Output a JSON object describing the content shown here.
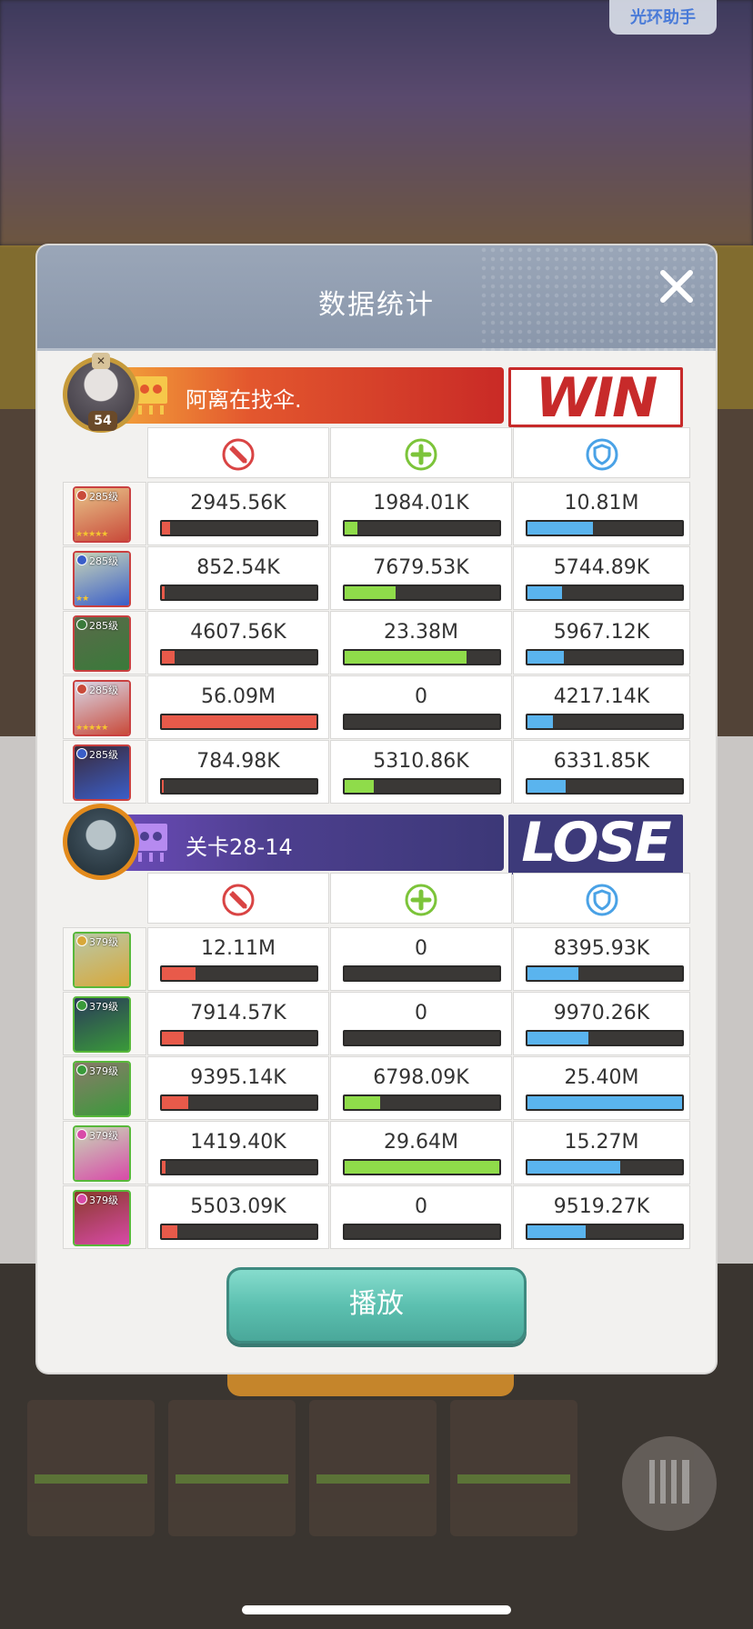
{
  "helper_badge": "光环助手",
  "dialog": {
    "title": "数据统计",
    "play_button": "播放"
  },
  "stat_columns": [
    "damage-icon",
    "heal-icon",
    "shield-icon"
  ],
  "colors": {
    "damage": "#e85a4a",
    "heal": "#8fdc4a",
    "shield": "#5ab4ee",
    "win_red": "#c72a2a",
    "lose_purple": "#3d3a7a"
  },
  "team_win": {
    "name": "阿离在找伞.",
    "level": "54",
    "result": "WIN",
    "heroes": [
      {
        "level": "285级",
        "stars": "★★★★★",
        "damage": "2945.56K",
        "heal": "1984.01K",
        "shield": "10.81M",
        "damage_pct": 5.3,
        "heal_pct": 8.5,
        "shield_pct": 42.6
      },
      {
        "level": "285级",
        "stars": "★★",
        "damage": "852.54K",
        "heal": "7679.53K",
        "shield": "5744.89K",
        "damage_pct": 1.5,
        "heal_pct": 32.8,
        "shield_pct": 22.6
      },
      {
        "level": "285级",
        "stars": "",
        "damage": "4607.56K",
        "heal": "23.38M",
        "shield": "5967.12K",
        "damage_pct": 8.2,
        "heal_pct": 78.9,
        "shield_pct": 23.5
      },
      {
        "level": "285级",
        "stars": "★★★★★",
        "damage": "56.09M",
        "heal": "0",
        "shield": "4217.14K",
        "damage_pct": 100,
        "heal_pct": 0,
        "shield_pct": 16.6
      },
      {
        "level": "285级",
        "stars": "",
        "damage": "784.98K",
        "heal": "5310.86K",
        "shield": "6331.85K",
        "damage_pct": 1.4,
        "heal_pct": 18.7,
        "shield_pct": 24.9
      }
    ]
  },
  "team_lose": {
    "name": "关卡28-14",
    "result": "LOSE",
    "heroes": [
      {
        "level": "379级",
        "damage": "12.11M",
        "heal": "0",
        "shield": "8395.93K",
        "damage_pct": 21.6,
        "heal_pct": 0,
        "shield_pct": 33.1
      },
      {
        "level": "379级",
        "damage": "7914.57K",
        "heal": "0",
        "shield": "9970.26K",
        "damage_pct": 14.1,
        "heal_pct": 0,
        "shield_pct": 39.3
      },
      {
        "level": "379级",
        "damage": "9395.14K",
        "heal": "6798.09K",
        "shield": "25.40M",
        "damage_pct": 16.8,
        "heal_pct": 22.9,
        "shield_pct": 100
      },
      {
        "level": "379级",
        "damage": "1419.40K",
        "heal": "29.64M",
        "shield": "15.27M",
        "damage_pct": 2.5,
        "heal_pct": 100,
        "shield_pct": 60.1
      },
      {
        "level": "379级",
        "damage": "5503.09K",
        "heal": "0",
        "shield": "9519.27K",
        "damage_pct": 9.8,
        "heal_pct": 0,
        "shield_pct": 37.5
      }
    ]
  }
}
